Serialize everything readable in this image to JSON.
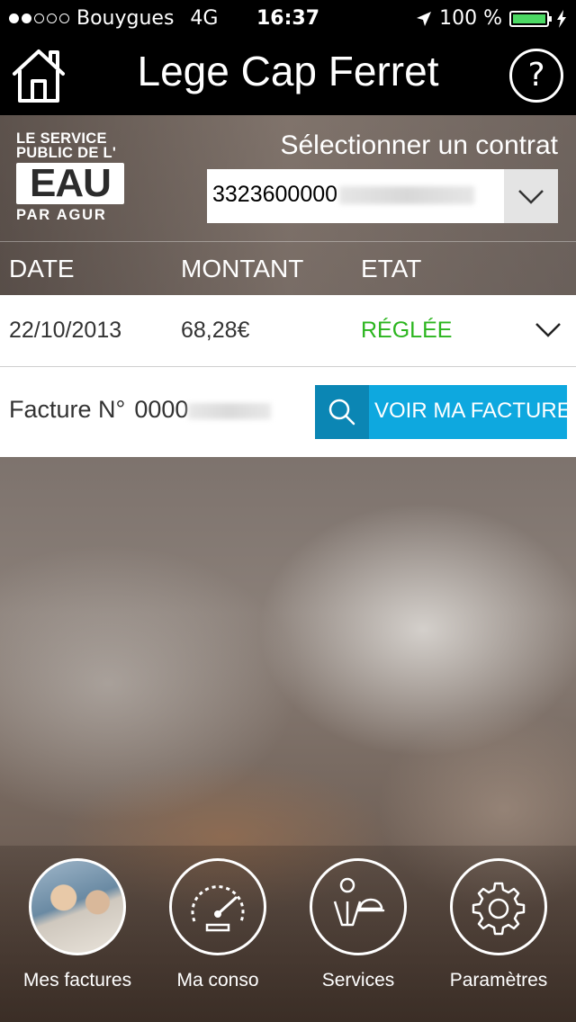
{
  "status_bar": {
    "carrier": "Bouygues",
    "network": "4G",
    "time": "16:37",
    "battery_percent": "100 %",
    "signal_bars_filled": 2,
    "signal_bars_total": 5
  },
  "header": {
    "title": "Lege Cap Ferret",
    "home_icon": "home-icon",
    "help_label": "?"
  },
  "logo": {
    "line1": "LE SERVICE",
    "line2": "PUBLIC DE L'",
    "main": "EAU",
    "line3": "PAR AGUR"
  },
  "contract": {
    "label": "Sélectionner un contrat",
    "value_visible": "3323600000"
  },
  "table": {
    "headers": [
      "DATE",
      "MONTANT",
      "ETAT"
    ],
    "rows": [
      {
        "date": "22/10/2013",
        "amount": "68,28€",
        "status": "RÉGLÉE"
      }
    ]
  },
  "invoice_detail": {
    "label": "Facture N°",
    "number_visible": "0000",
    "button_label": "VOIR MA FACTURE"
  },
  "bottom_nav": [
    {
      "label": "Mes factures",
      "icon": "photo-people-icon"
    },
    {
      "label": "Ma conso",
      "icon": "speedometer-icon"
    },
    {
      "label": "Services",
      "icon": "waiter-icon"
    },
    {
      "label": "Paramètres",
      "icon": "gear-icon"
    }
  ],
  "colors": {
    "accent_blue": "#0ea8df",
    "accent_blue_dark": "#0b86b4",
    "status_green": "#2bb51e",
    "battery_green": "#4cd964"
  }
}
